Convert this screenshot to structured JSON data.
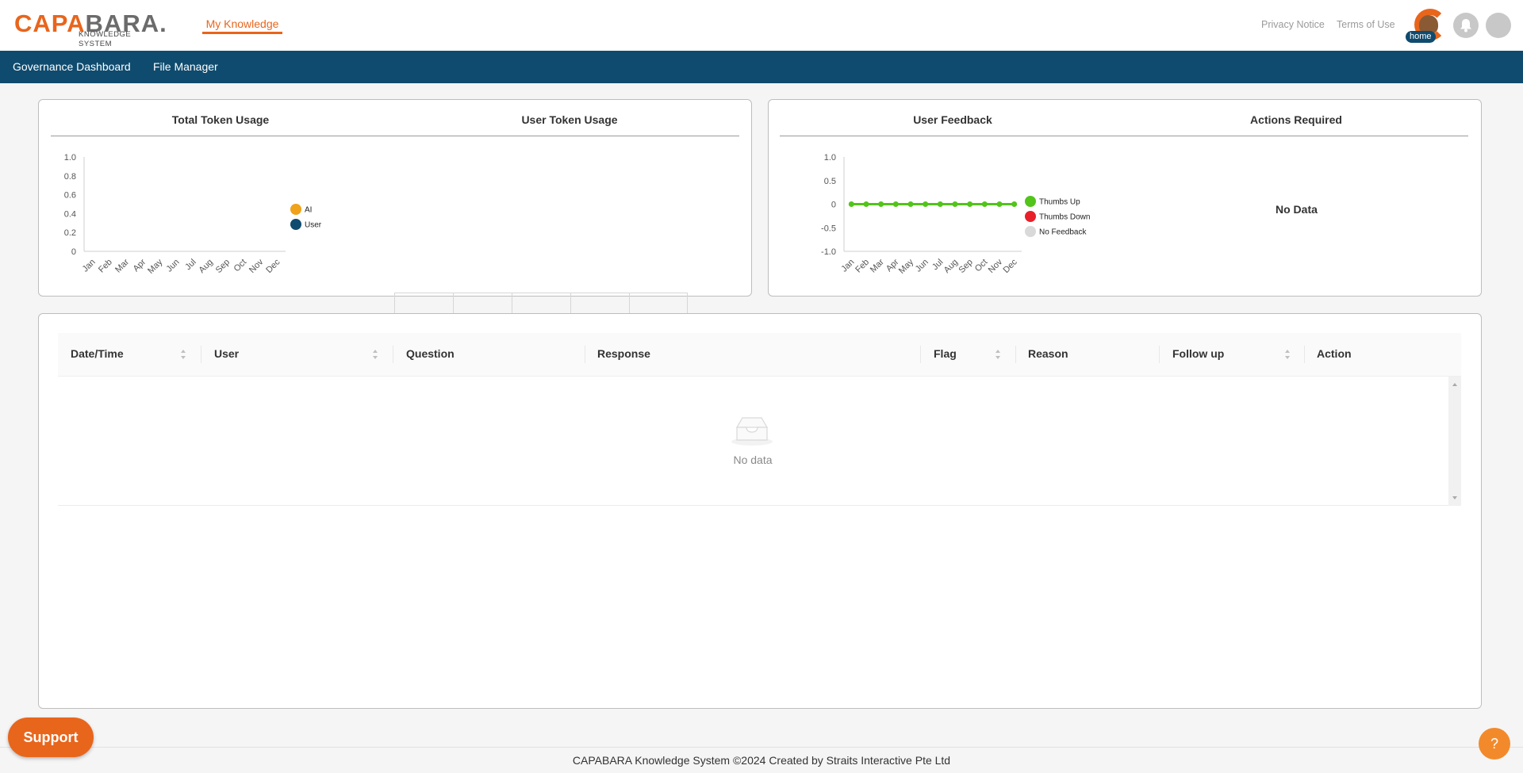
{
  "header": {
    "logo": {
      "word_orange": "CAPA",
      "word_grey": "BARA",
      "word_dot": ".",
      "subtitle": "KNOWLEDGE SYSTEM"
    },
    "nav_active": "My Knowledge",
    "privacy": "Privacy Notice",
    "terms": "Terms of Use",
    "home_badge": "home",
    "icons": [
      "bell-icon",
      "user-avatar"
    ]
  },
  "menubar": {
    "items": [
      "Governance Dashboard",
      "File Manager"
    ]
  },
  "colors": {
    "brand_orange": "#e8651c",
    "navy": "#0f4b6e",
    "ai": "#f0a21a",
    "user": "#0f4b6e",
    "thumbs_up": "#52c41a",
    "thumbs_down": "#e8202a",
    "no_feedback": "#d9d9d9"
  },
  "panels": {
    "left_titles": [
      "Total Token Usage",
      "User Token Usage"
    ],
    "right_titles": [
      "User Feedback",
      "Actions Required"
    ],
    "actions_required_empty": "No Data"
  },
  "chart_data": [
    {
      "type": "bar",
      "categories": [
        "Jan",
        "Feb",
        "Mar",
        "Apr",
        "May",
        "Jun",
        "Jul",
        "Aug",
        "Sep",
        "Oct",
        "Nov",
        "Dec"
      ],
      "series": [
        {
          "name": "AI",
          "values": []
        },
        {
          "name": "User",
          "values": []
        }
      ],
      "ylim": [
        0,
        1.0
      ],
      "yticks": [
        "1.0",
        "0.8",
        "0.6",
        "0.4",
        "0.2",
        "0"
      ],
      "legend": "right"
    },
    {
      "type": "line",
      "categories": [
        "Jan",
        "Feb",
        "Mar",
        "Apr",
        "May",
        "Jun",
        "Jul",
        "Aug",
        "Sep",
        "Oct",
        "Nov",
        "Dec"
      ],
      "series": [
        {
          "name": "Thumbs Up",
          "values": [
            0,
            0,
            0,
            0,
            0,
            0,
            0,
            0,
            0,
            0,
            0,
            0
          ]
        },
        {
          "name": "Thumbs Down",
          "values": []
        },
        {
          "name": "No Feedback",
          "values": []
        }
      ],
      "ylim": [
        -1.0,
        1.0
      ],
      "yticks": [
        "1.0",
        "0.5",
        "0",
        "-0.5",
        "-1.0"
      ],
      "legend": "right"
    }
  ],
  "table": {
    "columns": [
      "Date/Time",
      "User",
      "Question",
      "Response",
      "Flag",
      "Reason",
      "Follow up",
      "Action"
    ],
    "empty_text": "No data"
  },
  "footer": {
    "text": "CAPABARA Knowledge System ©2024  Created by Straits Interactive Pte Ltd"
  },
  "support_label": "Support",
  "help_label": "?"
}
